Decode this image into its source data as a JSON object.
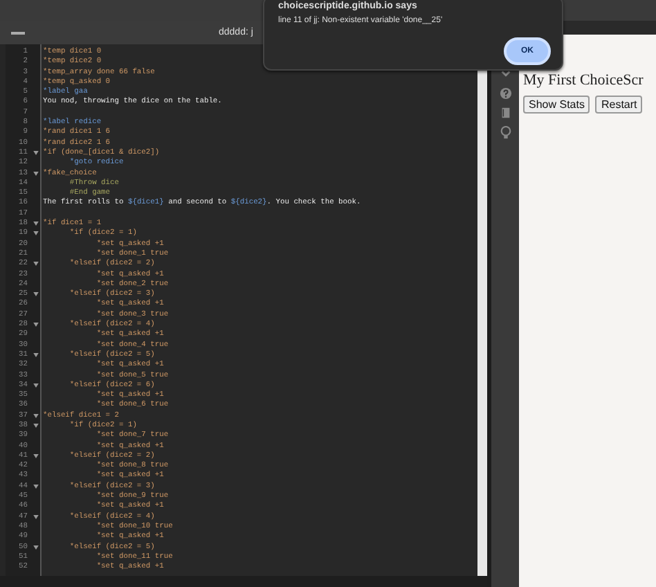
{
  "editor": {
    "title": "ddddd: j",
    "lines": [
      {
        "number": "1",
        "tokens": [
          {
            "kind": "command",
            "text": "*temp dice1 0"
          }
        ]
      },
      {
        "number": "2",
        "tokens": [
          {
            "kind": "command",
            "text": "*temp dice2 0"
          }
        ]
      },
      {
        "number": "3",
        "tokens": [
          {
            "kind": "command",
            "text": "*temp_array done 66 false"
          }
        ]
      },
      {
        "number": "4",
        "tokens": [
          {
            "kind": "command",
            "text": "*temp q_asked 0"
          }
        ]
      },
      {
        "number": "5",
        "tokens": [
          {
            "kind": "label",
            "text": "*label gaa"
          }
        ]
      },
      {
        "number": "6",
        "tokens": [
          {
            "kind": "plain",
            "text": "You nod, throwing the dice on the table."
          }
        ]
      },
      {
        "number": "7"
      },
      {
        "number": "8",
        "tokens": [
          {
            "kind": "label",
            "text": "*label redice"
          }
        ]
      },
      {
        "number": "9",
        "tokens": [
          {
            "kind": "command",
            "text": "*rand dice1 1 6"
          }
        ]
      },
      {
        "number": "10",
        "tokens": [
          {
            "kind": "command",
            "text": "*rand dice2 1 6"
          }
        ]
      },
      {
        "number": "11",
        "fold": true,
        "tokens": [
          {
            "kind": "command",
            "text": "*if (done_[dice1 & dice2])"
          }
        ]
      },
      {
        "number": "12",
        "tokens": [
          {
            "kind": "label",
            "text": "      *goto redice"
          }
        ]
      },
      {
        "number": "13",
        "fold": true,
        "tokens": [
          {
            "kind": "command",
            "text": "*fake_choice"
          }
        ]
      },
      {
        "number": "14",
        "tokens": [
          {
            "kind": "option",
            "text": "      #Throw dice"
          }
        ]
      },
      {
        "number": "15",
        "tokens": [
          {
            "kind": "option",
            "text": "      #End game"
          }
        ]
      },
      {
        "number": "16",
        "tokens": [
          {
            "kind": "plain",
            "text": "The first rolls to "
          },
          {
            "kind": "variable",
            "text": "${dice1}"
          },
          {
            "kind": "plain",
            "text": " and second to "
          },
          {
            "kind": "variable",
            "text": "${dice2}"
          },
          {
            "kind": "plain",
            "text": ". You check the book."
          }
        ]
      },
      {
        "number": "17"
      },
      {
        "number": "18",
        "fold": true,
        "tokens": [
          {
            "kind": "command",
            "text": "*if dice1 = 1"
          }
        ]
      },
      {
        "number": "19",
        "fold": true,
        "tokens": [
          {
            "kind": "command",
            "text": "      *if (dice2 = 1)"
          }
        ]
      },
      {
        "number": "20",
        "tokens": [
          {
            "kind": "command",
            "text": "            *set q_asked +1"
          }
        ]
      },
      {
        "number": "21",
        "tokens": [
          {
            "kind": "command",
            "text": "            *set done_1 true"
          }
        ]
      },
      {
        "number": "22",
        "fold": true,
        "tokens": [
          {
            "kind": "command",
            "text": "      *elseif (dice2 = 2)"
          }
        ]
      },
      {
        "number": "23",
        "tokens": [
          {
            "kind": "command",
            "text": "            *set q_asked +1"
          }
        ]
      },
      {
        "number": "24",
        "tokens": [
          {
            "kind": "command",
            "text": "            *set done_2 true"
          }
        ]
      },
      {
        "number": "25",
        "fold": true,
        "tokens": [
          {
            "kind": "command",
            "text": "      *elseif (dice2 = 3)"
          }
        ]
      },
      {
        "number": "26",
        "tokens": [
          {
            "kind": "command",
            "text": "            *set q_asked +1"
          }
        ]
      },
      {
        "number": "27",
        "tokens": [
          {
            "kind": "command",
            "text": "            *set done_3 true"
          }
        ]
      },
      {
        "number": "28",
        "fold": true,
        "tokens": [
          {
            "kind": "command",
            "text": "      *elseif (dice2 = 4)"
          }
        ]
      },
      {
        "number": "29",
        "tokens": [
          {
            "kind": "command",
            "text": "            *set q_asked +1"
          }
        ]
      },
      {
        "number": "30",
        "tokens": [
          {
            "kind": "command",
            "text": "            *set done_4 true"
          }
        ]
      },
      {
        "number": "31",
        "fold": true,
        "tokens": [
          {
            "kind": "command",
            "text": "      *elseif (dice2 = 5)"
          }
        ]
      },
      {
        "number": "32",
        "tokens": [
          {
            "kind": "command",
            "text": "            *set q_asked +1"
          }
        ]
      },
      {
        "number": "33",
        "tokens": [
          {
            "kind": "command",
            "text": "            *set done_5 true"
          }
        ]
      },
      {
        "number": "34",
        "fold": true,
        "tokens": [
          {
            "kind": "command",
            "text": "      *elseif (dice2 = 6)"
          }
        ]
      },
      {
        "number": "35",
        "tokens": [
          {
            "kind": "command",
            "text": "            *set q_asked +1"
          }
        ]
      },
      {
        "number": "36",
        "tokens": [
          {
            "kind": "command",
            "text": "            *set done_6 true"
          }
        ]
      },
      {
        "number": "37",
        "fold": true,
        "tokens": [
          {
            "kind": "command",
            "text": "*elseif dice1 = 2"
          }
        ]
      },
      {
        "number": "38",
        "fold": true,
        "tokens": [
          {
            "kind": "command",
            "text": "      *if (dice2 = 1)"
          }
        ]
      },
      {
        "number": "39",
        "tokens": [
          {
            "kind": "command",
            "text": "            *set done_7 true"
          }
        ]
      },
      {
        "number": "40",
        "tokens": [
          {
            "kind": "command",
            "text": "            *set q_asked +1"
          }
        ]
      },
      {
        "number": "41",
        "fold": true,
        "tokens": [
          {
            "kind": "command",
            "text": "      *elseif (dice2 = 2)"
          }
        ]
      },
      {
        "number": "42",
        "tokens": [
          {
            "kind": "command",
            "text": "            *set done_8 true"
          }
        ]
      },
      {
        "number": "43",
        "tokens": [
          {
            "kind": "command",
            "text": "            *set q_asked +1"
          }
        ]
      },
      {
        "number": "44",
        "fold": true,
        "tokens": [
          {
            "kind": "command",
            "text": "      *elseif (dice2 = 3)"
          }
        ]
      },
      {
        "number": "45",
        "tokens": [
          {
            "kind": "command",
            "text": "            *set done_9 true"
          }
        ]
      },
      {
        "number": "46",
        "tokens": [
          {
            "kind": "command",
            "text": "            *set q_asked +1"
          }
        ]
      },
      {
        "number": "47",
        "fold": true,
        "tokens": [
          {
            "kind": "command",
            "text": "      *elseif (dice2 = 4)"
          }
        ]
      },
      {
        "number": "48",
        "tokens": [
          {
            "kind": "command",
            "text": "            *set done_10 true"
          }
        ]
      },
      {
        "number": "49",
        "tokens": [
          {
            "kind": "command",
            "text": "            *set q_asked +1"
          }
        ]
      },
      {
        "number": "50",
        "fold": true,
        "tokens": [
          {
            "kind": "command",
            "text": "      *elseif (dice2 = 5)"
          }
        ]
      },
      {
        "number": "51",
        "tokens": [
          {
            "kind": "command",
            "text": "            *set done_11 true"
          }
        ]
      },
      {
        "number": "52",
        "tokens": [
          {
            "kind": "command",
            "text": "            *set q_asked +1"
          }
        ]
      }
    ]
  },
  "preview": {
    "title": "My First ChoiceScr",
    "buttons": [
      "Show Stats",
      "Restart"
    ]
  },
  "dialog": {
    "title": "choicescriptide.github.io says",
    "message": "line 11 of jj: Non-existent variable 'done__25'",
    "button": "OK"
  }
}
